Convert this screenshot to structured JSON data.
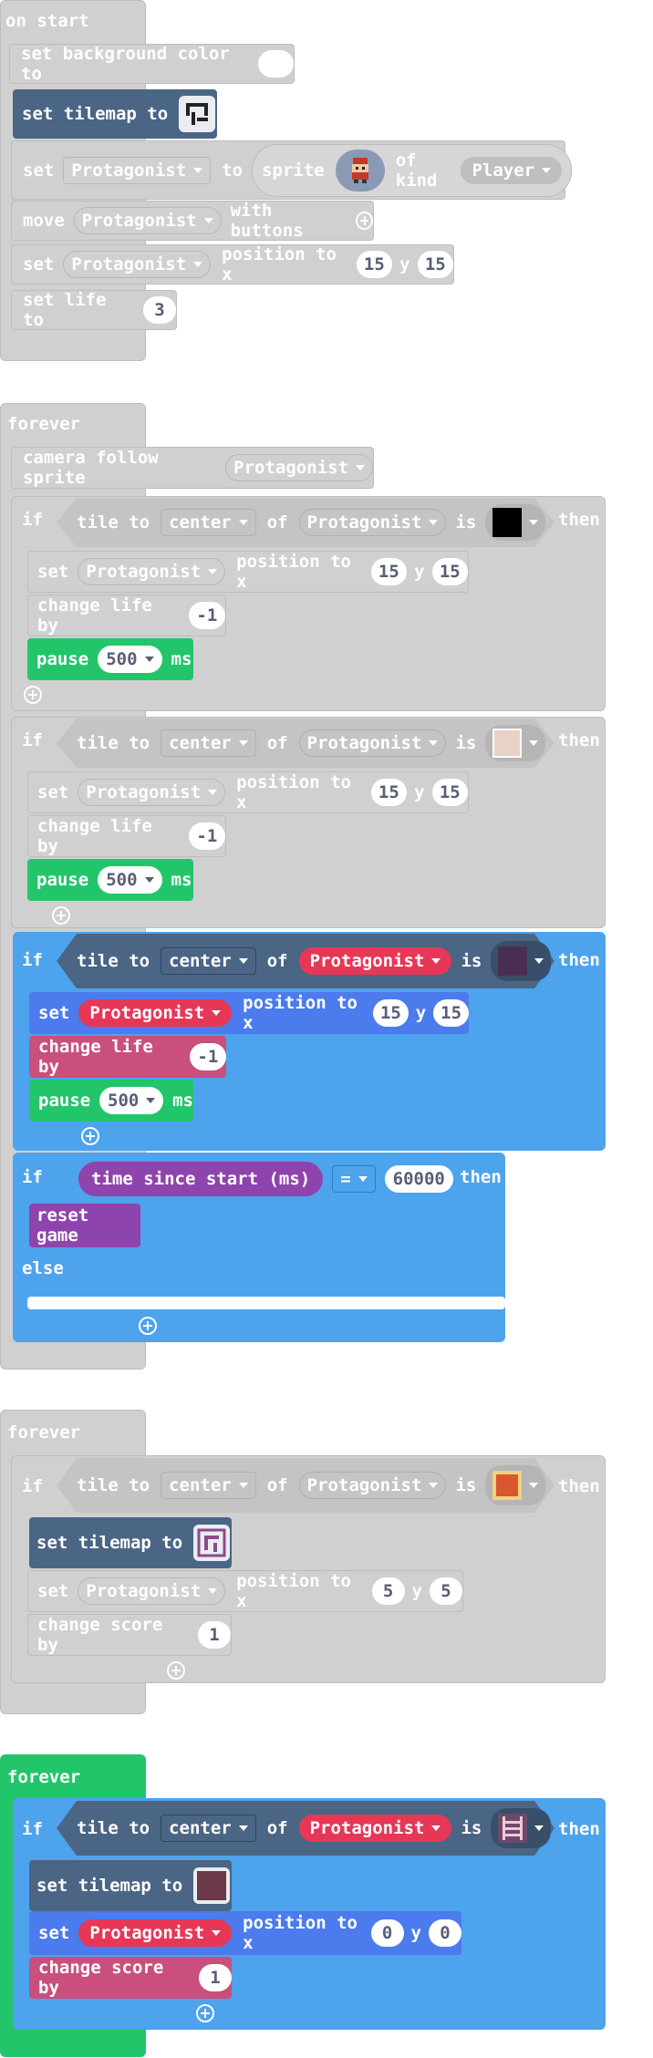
{
  "colors": {
    "disabled": "#d0d0d0",
    "loops": "#4caf50",
    "logic": "#4da3ec",
    "scene": "#4b6584",
    "sprites": "#4b7bec",
    "info": "#c94f7c",
    "game": "#8e44ad",
    "control": "#23c56a",
    "accent_red": "#e63757"
  },
  "icons": {
    "add": "plus-circle-icon",
    "remove": "minus-circle-icon",
    "dropdown": "caret-down-icon"
  },
  "group1": {
    "hat": "on start",
    "set_bg": "set background color to",
    "set_tilemap": "set tilemap to",
    "set": "set",
    "sprite_var": "Protagonist",
    "to": "to",
    "sprite": "sprite",
    "of_kind": "of kind",
    "kind": "Player",
    "move": "move",
    "with_buttons": "with buttons",
    "position_to_x": "position to x",
    "y": "y",
    "x_val": "15",
    "y_val": "15",
    "set_life": "set life to",
    "life_val": "3"
  },
  "group2": {
    "hat": "forever",
    "camera": "camera follow sprite",
    "sprite_var": "Protagonist",
    "if": "if",
    "tile_to": "tile to",
    "center": "center",
    "of": "of",
    "is": "is",
    "then": "then",
    "set": "set",
    "position_to_x": "position to x",
    "y": "y",
    "x_val": "15",
    "y_val": "15",
    "change_life": "change life by",
    "life_delta": "-1",
    "pause": "pause",
    "pause_val": "500",
    "ms": "ms",
    "time_since": "time since start (ms)",
    "eq": "=",
    "time_val": "60000",
    "reset": "reset game",
    "else": "else"
  },
  "group3": {
    "hat": "forever",
    "if": "if",
    "tile_to": "tile to",
    "center": "center",
    "of": "of",
    "sprite_var": "Protagonist",
    "is": "is",
    "then": "then",
    "set_tilemap": "set tilemap to",
    "set": "set",
    "position_to_x": "position to x",
    "y": "y",
    "x_val": "5",
    "y_val": "5",
    "change_score": "change score by",
    "score_val": "1"
  },
  "group4": {
    "hat": "forever",
    "if": "if",
    "tile_to": "tile to",
    "center": "center",
    "of": "of",
    "sprite_var": "Protagonist",
    "is": "is",
    "then": "then",
    "set_tilemap": "set tilemap to",
    "set": "set",
    "position_to_x": "position to x",
    "y": "y",
    "x_val": "0",
    "y_val": "0",
    "change_score": "change score by",
    "score_val": "1"
  }
}
